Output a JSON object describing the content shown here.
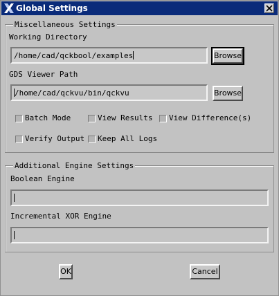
{
  "window": {
    "title": "Global Settings"
  },
  "misc": {
    "group_title": "Miscellaneous Settings",
    "working_dir": {
      "label": "Working Directory",
      "value": "/home/cad/qckbool/examples",
      "browse": "Browse"
    },
    "gds_path": {
      "label": "GDS Viewer Path",
      "value": "/home/cad/qckvu/bin/qckvu",
      "browse": "Browse"
    },
    "options": [
      {
        "label": "Batch Mode",
        "checked": false
      },
      {
        "label": "View Results",
        "checked": false
      },
      {
        "label": "View Difference(s)",
        "checked": false
      },
      {
        "label": "Verify Output",
        "checked": false
      },
      {
        "label": "Keep All Logs",
        "checked": false
      }
    ]
  },
  "engine": {
    "group_title": "Additional Engine Settings",
    "boolean": {
      "label": "Boolean Engine",
      "value": ""
    },
    "xor": {
      "label": "Incremental XOR Engine",
      "value": ""
    }
  },
  "buttons": {
    "ok": "OK",
    "cancel": "Cancel"
  },
  "icons": {
    "app": "x-logo-icon",
    "close": "close-icon"
  }
}
